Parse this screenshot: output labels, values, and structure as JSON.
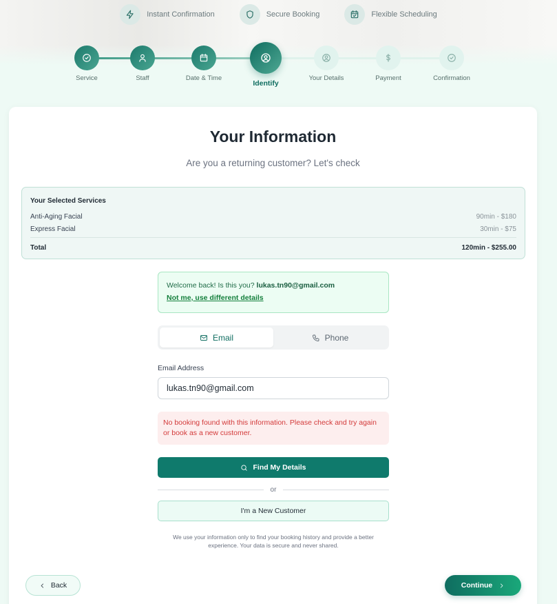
{
  "features": [
    {
      "icon": "lightning-icon",
      "label": "Instant Confirmation"
    },
    {
      "icon": "shield-icon",
      "label": "Secure Booking"
    },
    {
      "icon": "calendar-check-icon",
      "label": "Flexible Scheduling"
    }
  ],
  "steps": [
    {
      "label": "Service",
      "state": "done",
      "icon": "check-circle-icon"
    },
    {
      "label": "Staff",
      "state": "done",
      "icon": "user-icon"
    },
    {
      "label": "Date & Time",
      "state": "done",
      "icon": "calendar-icon"
    },
    {
      "label": "Identify",
      "state": "active",
      "icon": "user-circle-icon"
    },
    {
      "label": "Your Details",
      "state": "pending",
      "icon": "user-circle-icon"
    },
    {
      "label": "Payment",
      "state": "pending",
      "icon": "dollar-icon"
    },
    {
      "label": "Confirmation",
      "state": "pending",
      "icon": "check-circle-icon"
    }
  ],
  "main": {
    "title": "Your Information",
    "subtitle": "Are you a returning customer? Let's check"
  },
  "summary": {
    "title": "Your Selected Services",
    "services": [
      {
        "name": "Anti-Aging Facial",
        "price": "90min - $180"
      },
      {
        "name": "Express Facial",
        "price": "30min - $75"
      }
    ],
    "total_label": "Total",
    "total_value": "120min - $255.00"
  },
  "welcome": {
    "prefix": "Welcome back! Is this you?",
    "email": "lukas.tn90@gmail.com",
    "not_me": "Not me, use different details"
  },
  "lookup": {
    "tabs": [
      {
        "label": "Email",
        "icon": "mail-icon",
        "selected": true
      },
      {
        "label": "Phone",
        "icon": "phone-icon",
        "selected": false
      }
    ],
    "field_label": "Email Address",
    "field_value": "lukas.tn90@gmail.com",
    "error": "No booking found with this information. Please check and try again or book as a new customer.",
    "find_label": "Find My Details",
    "or_label": "or",
    "new_customer_label": "I'm a New Customer",
    "privacy_note": "We use your information only to find your booking history and provide a better experience. Your data is secure and never shared."
  },
  "nav": {
    "back_label": "Back",
    "continue_label": "Continue"
  },
  "colors": {
    "brand": "#0f7a6c",
    "error": "#d33a3a",
    "success_bg": "#ecfdf3"
  }
}
